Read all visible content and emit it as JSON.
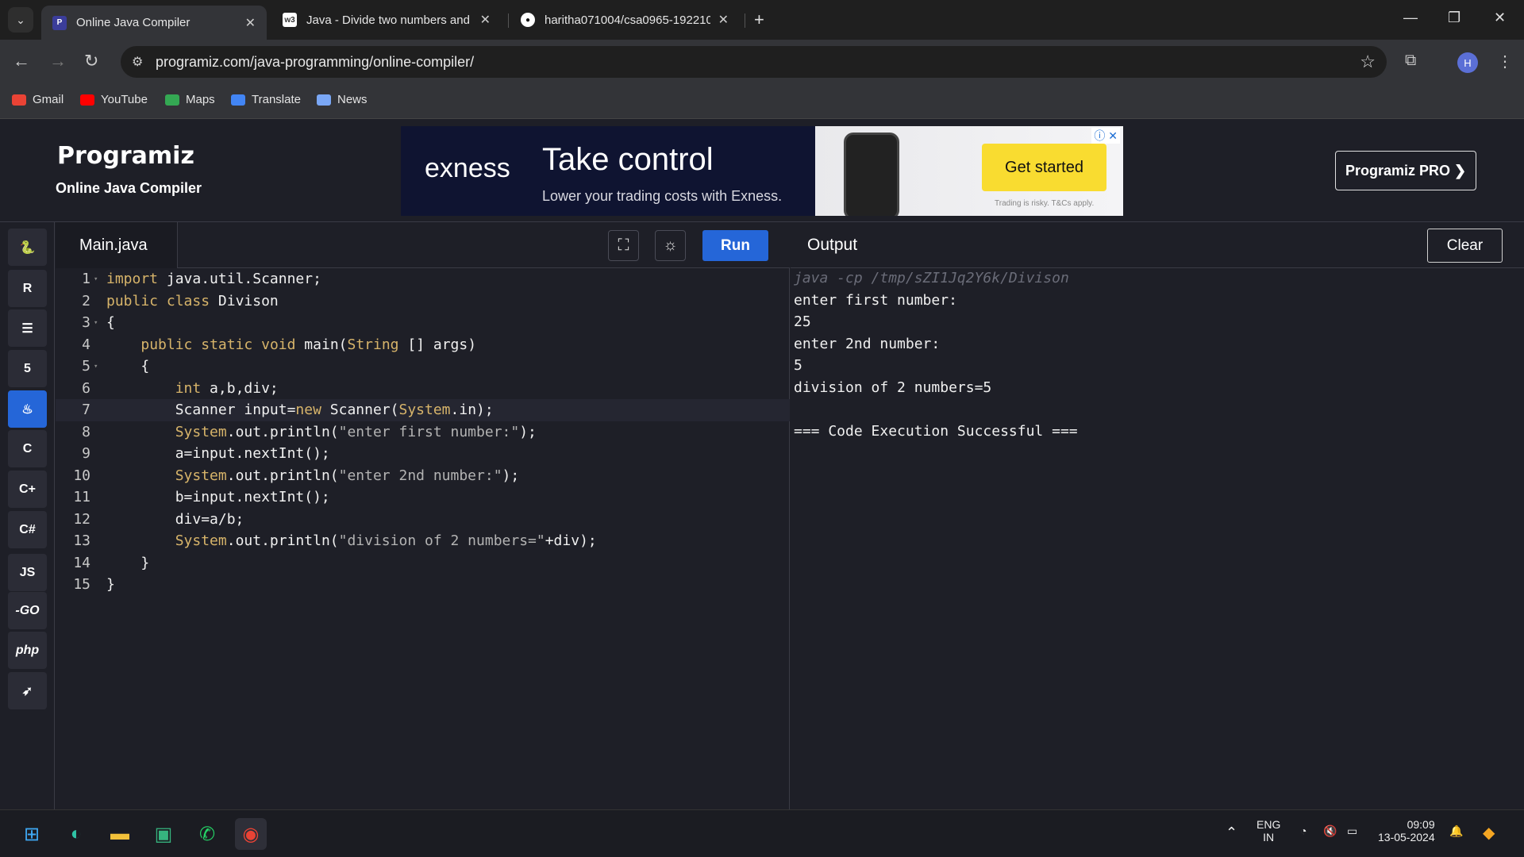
{
  "browser": {
    "tabs": [
      {
        "title": "Online Java Compiler",
        "active": true
      },
      {
        "title": "Java - Divide two numbers and",
        "active": false
      },
      {
        "title": "haritha071004/csa0965-192210",
        "active": false
      }
    ],
    "url": "programiz.com/java-programming/online-compiler/",
    "profile_initial": "H",
    "bookmarks": [
      "Gmail",
      "YouTube",
      "Maps",
      "Translate",
      "News"
    ]
  },
  "site": {
    "logo": "Programiz",
    "subtitle": "Online Java Compiler",
    "pro_button": "Programiz PRO ❯"
  },
  "ad": {
    "brand": "exness",
    "title": "Take control",
    "subtitle": "Lower your trading costs with Exness.",
    "cta": "Get started",
    "disclaimer": "Trading is risky. T&Cs apply."
  },
  "rail": {
    "languages": [
      "python",
      "r",
      "sql",
      "html",
      "java",
      "c",
      "cpp",
      "csharp",
      "JS",
      "GO",
      "php",
      "swift"
    ],
    "js_label": "JS",
    "go_label": "-GO",
    "php_label": "php"
  },
  "editor": {
    "file_name": "Main.java",
    "run_label": "Run",
    "lines": [
      "import java.util.Scanner;",
      "public class Divison",
      "{",
      "    public static void main(String [] args)",
      "    {",
      "        int a,b,div;",
      "        Scanner input=new Scanner(System.in);",
      "        System.out.println(\"enter first number:\");",
      "        a=input.nextInt();",
      "        System.out.println(\"enter 2nd number:\");",
      "        b=input.nextInt();",
      "        div=a/b;",
      "        System.out.println(\"division of 2 numbers=\"+div);",
      "    }",
      "}"
    ]
  },
  "output": {
    "title": "Output",
    "clear_label": "Clear",
    "lines": [
      "java -cp /tmp/sZI1Jq2Y6k/Divison",
      "enter first number:",
      "25",
      "enter 2nd number:",
      "5",
      "division of 2 numbers=5",
      "",
      "=== Code Execution Successful ==="
    ]
  },
  "taskbar": {
    "lang": "ENG",
    "region": "IN",
    "time": "09:09",
    "date": "13-05-2024"
  },
  "colors": {
    "accent": "#2566d8",
    "background": "#1e1f27",
    "keyword": "#d7b46a",
    "ad_cta": "#f9dc30"
  }
}
